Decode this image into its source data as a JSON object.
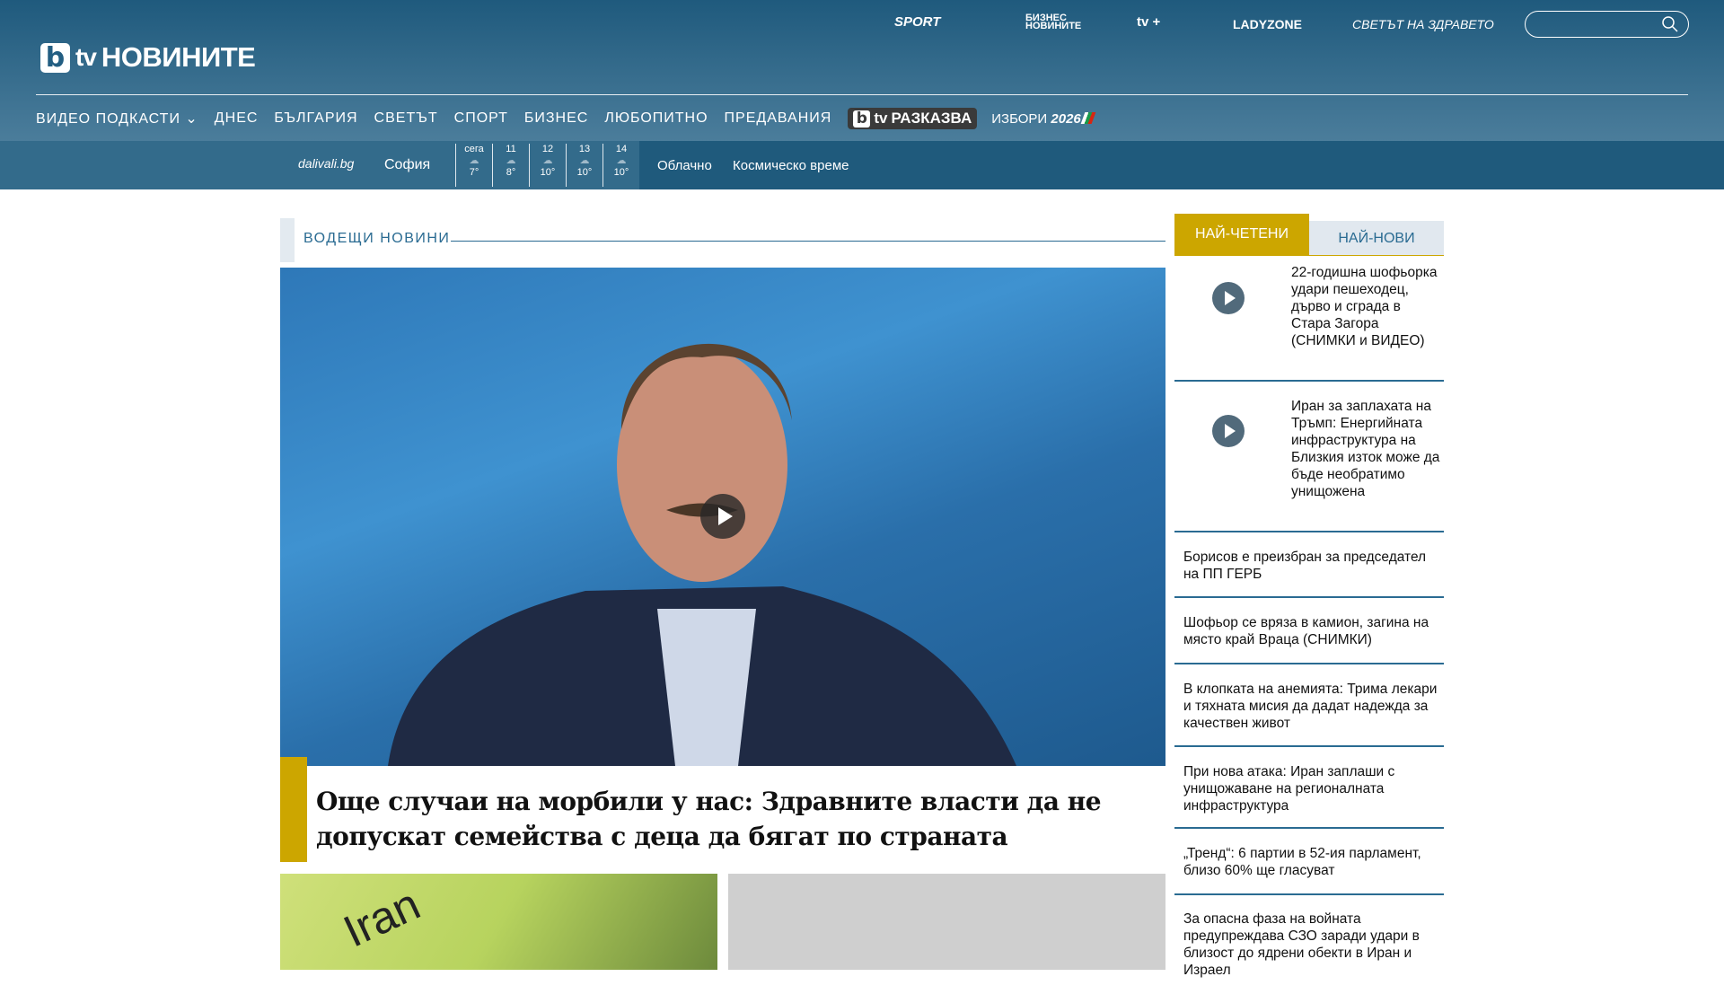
{
  "header": {
    "logo_b": "b",
    "logo_tv": "tv",
    "logo_name": "НОВИНИТЕ",
    "partners": [
      "SPORT",
      "БИЗНЕС НОВИНИТЕ",
      "tv +",
      "LADYZONE",
      "СВЕТЪТ НА ЗДРАВЕТО"
    ],
    "search_placeholder": ""
  },
  "nav": [
    "ВИДЕО ПОДКАСТИ",
    "ДНЕС",
    "БЪЛГАРИЯ",
    "СВЕТЪТ",
    "СПОРТ",
    "БИЗНЕС",
    "ЛЮБОПИТНО",
    "ПРЕДАВАНИЯ"
  ],
  "nav_raz": "РАЗКАЗВА",
  "nav_raz_tv": "tv",
  "nav_elections": "ИЗБОРИ",
  "nav_elections_year": "2026",
  "weather": {
    "provider": "dalivali.bg",
    "city": "София",
    "days": [
      {
        "label": "сега",
        "temp": "7°"
      },
      {
        "label": "11",
        "temp": "8°"
      },
      {
        "label": "12",
        "temp": "10°"
      },
      {
        "label": "13",
        "temp": "10°"
      },
      {
        "label": "14",
        "temp": "10°"
      }
    ],
    "condition": "Облачно",
    "space": "Космическо време"
  },
  "main": {
    "section_title": "ВОДЕЩИ НОВИНИ",
    "headline": "Още случаи на морбили у нас: Здравните власти да не допускат семейства с деца да бягат по страната",
    "card1_text": "Iran"
  },
  "sidebar": {
    "tabs": [
      "НАЙ-ЧЕТЕНИ",
      "НАЙ-НОВИ"
    ],
    "items": [
      "22-годишна шофьорка удари пешеходец, дърво и сграда в Стара Загора (СНИМКИ и ВИДЕО)",
      "Иран за заплахата на Тръмп: Енергийната инфраструктура на Близкия изток може да бъде необратимо унищожена",
      "Борисов е преизбран за председател на ПП ГЕРБ",
      "Шофьор се вряза в камион, загина на място край Враца (СНИМКИ)",
      "В клопката на анемията: Трима лекари и тяхната мисия да дадат надежда за качествен живот",
      "При нова атака: Иран заплаши с унищожаване на регионалната инфраструктура",
      "„Тренд“: 6 партии в 52-ия парламент, близо 60% ще гласуват",
      "За опасна фаза на войната предупреждава СЗО заради удари в близост до ядрени обекти в Иран и Израел"
    ]
  },
  "colors": {
    "accent": "#cca600",
    "brand": "#2a6b92"
  }
}
